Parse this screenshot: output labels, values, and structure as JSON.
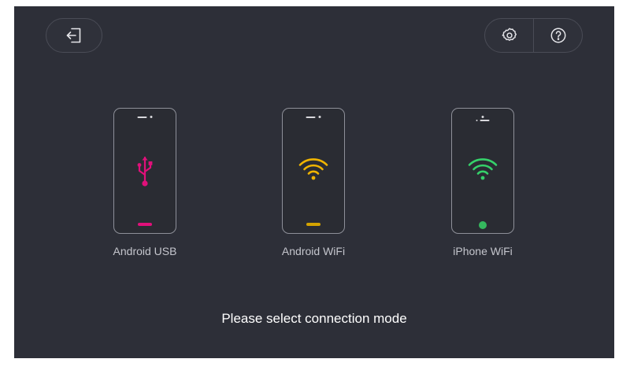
{
  "header": {
    "exit_icon": "exit-door-icon",
    "settings_icon": "gear-icon",
    "help_icon": "question-circle-icon"
  },
  "modes": [
    {
      "label": "Android USB",
      "icon": "usb-icon",
      "accent": "#e0107a",
      "home_style": "bar"
    },
    {
      "label": "Android WiFi",
      "icon": "wifi-icon",
      "accent": "#f0b400",
      "home_style": "bar"
    },
    {
      "label": "iPhone WiFi",
      "icon": "wifi-icon",
      "accent": "#35d16a",
      "home_style": "dot"
    }
  ],
  "prompt": "Please select connection mode",
  "colors": {
    "background": "#2d2f38",
    "border": "#4a4c56",
    "text_primary": "#ffffff",
    "text_secondary": "#c4c5cc"
  }
}
